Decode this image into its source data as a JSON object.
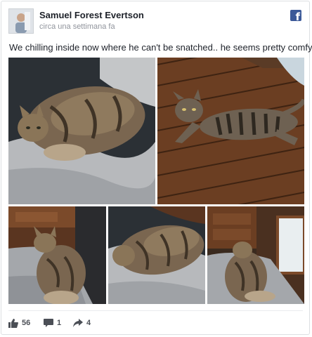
{
  "post": {
    "author": "Samuel Forest Evertson",
    "time": "circa una settimana fa",
    "text": "We chilling inside now where he can't be snatched.. he seems pretty comfy."
  },
  "icons": {
    "brand": "facebook-icon",
    "like": "thumbs-up-icon",
    "comment": "comment-icon",
    "share": "share-arrow-icon"
  },
  "stats": {
    "likes": "56",
    "comments": "1",
    "shares": "4"
  },
  "colors": {
    "brand": "#3b5998",
    "text": "#1d2129",
    "meta": "#90949c"
  }
}
